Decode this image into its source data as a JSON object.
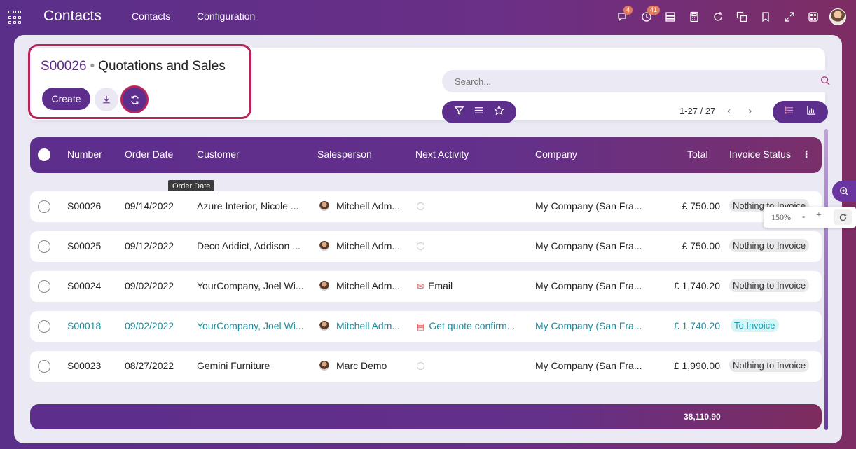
{
  "topbar": {
    "app_title": "Contacts",
    "nav": [
      "Contacts",
      "Configuration"
    ],
    "icons": [
      {
        "name": "chat-icon",
        "badge": "4"
      },
      {
        "name": "activity-clock-icon",
        "badge": "41"
      },
      {
        "name": "server-icon",
        "badge": ""
      },
      {
        "name": "calculator-icon",
        "badge": ""
      },
      {
        "name": "refresh-icon",
        "badge": ""
      },
      {
        "name": "translate-icon",
        "badge": ""
      },
      {
        "name": "bookmark-icon",
        "badge": ""
      },
      {
        "name": "fullscreen-icon",
        "badge": ""
      },
      {
        "name": "dice-icon",
        "badge": ""
      }
    ]
  },
  "control_panel": {
    "breadcrumb_link": "S00026",
    "breadcrumb_sep": "•",
    "breadcrumb_current": "Quotations and Sales",
    "create_label": "Create",
    "search_placeholder": "Search...",
    "pager": "1-27 / 27",
    "pager_prev": "‹",
    "pager_next": "›"
  },
  "table": {
    "columns": [
      "Number",
      "Order Date",
      "Customer",
      "Salesperson",
      "Next Activity",
      "Company",
      "Total",
      "Invoice Status"
    ],
    "tooltip": "Order Date",
    "rows": [
      {
        "number": "S00026",
        "date": "09/14/2022",
        "customer": "Azure Interior, Nicole ...",
        "salesperson": "Mitchell Adm...",
        "activity": "",
        "activity_icon": "clock",
        "company": "My Company (San Fra...",
        "total": "£ 750.00",
        "status": "Nothing to Invoice",
        "status_type": "nothing",
        "highlight": false
      },
      {
        "number": "S00025",
        "date": "09/12/2022",
        "customer": "Deco Addict, Addison ...",
        "salesperson": "Mitchell Adm...",
        "activity": "",
        "activity_icon": "clock",
        "company": "My Company (San Fra...",
        "total": "£ 750.00",
        "status": "Nothing to Invoice",
        "status_type": "nothing",
        "highlight": false
      },
      {
        "number": "S00024",
        "date": "09/02/2022",
        "customer": "YourCompany, Joel Wi...",
        "salesperson": "Mitchell Adm...",
        "activity": "Email",
        "activity_icon": "email",
        "company": "My Company (San Fra...",
        "total": "£ 1,740.20",
        "status": "Nothing to Invoice",
        "status_type": "nothing",
        "highlight": false
      },
      {
        "number": "S00018",
        "date": "09/02/2022",
        "customer": "YourCompany, Joel Wi...",
        "salesperson": "Mitchell Adm...",
        "activity": "Get quote confirm...",
        "activity_icon": "task",
        "company": "My Company (San Fra...",
        "total": "£ 1,740.20",
        "status": "To Invoice",
        "status_type": "to-invoice",
        "highlight": true
      },
      {
        "number": "S00023",
        "date": "08/27/2022",
        "customer": "Gemini Furniture",
        "salesperson": "Marc Demo",
        "activity": "",
        "activity_icon": "clock",
        "company": "My Company (San Fra...",
        "total": "£ 1,990.00",
        "status": "Nothing to Invoice",
        "status_type": "nothing",
        "highlight": false
      }
    ],
    "footer_total": "38,110.90"
  },
  "zoom": {
    "level": "150%",
    "minus": "-",
    "plus": "+"
  },
  "colors": {
    "primary": "#5d2e8c",
    "highlight_border": "#b8235a",
    "link_teal": "#1a8c9e"
  }
}
